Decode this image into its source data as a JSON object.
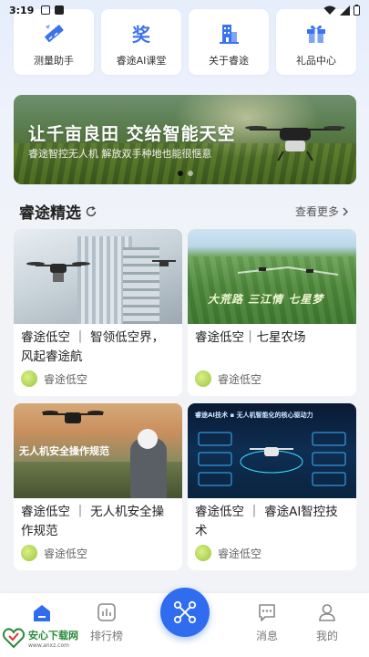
{
  "status_bar": {
    "time": "3:19"
  },
  "quick_menu": [
    {
      "label": "测量助手",
      "icon": "ruler-icon"
    },
    {
      "label": "睿途AI课堂",
      "icon": "award-icon"
    },
    {
      "label": "关于睿途",
      "icon": "building-icon"
    },
    {
      "label": "礼品中心",
      "icon": "gift-icon"
    }
  ],
  "banner": {
    "title": "让千亩良田 交给智能天空",
    "subtitle": "睿途智控无人机 解放双手种地也能很惬意"
  },
  "section": {
    "title": "睿途精选",
    "more_label": "查看更多"
  },
  "cards": [
    {
      "title": "睿途低空 ｜ 智领低空界，风起睿途航",
      "author": "睿途低空",
      "img_text": ""
    },
    {
      "title": "睿途低空｜七星农场",
      "author": "睿途低空",
      "img_text": "大荒路 三江情 七星梦"
    },
    {
      "title": "睿途低空 ｜ 无人机安全操作规范",
      "author": "睿途低空",
      "img_text": "无人机安全操作规范"
    },
    {
      "title": "睿途低空 ｜ 睿途AI智控技术",
      "author": "睿途低空",
      "img_text": "睿途AI技术 ▪ 无人机智能化的核心驱动力"
    }
  ],
  "nav": [
    {
      "label": "",
      "icon": "home-icon"
    },
    {
      "label": "排行榜",
      "icon": "chart-icon"
    },
    {
      "label": "消息",
      "icon": "message-icon"
    },
    {
      "label": "我的",
      "icon": "user-icon"
    }
  ],
  "watermark": {
    "text": "安心下载网",
    "url": "www.anxz.com"
  },
  "colors": {
    "accent": "#2f6cf0",
    "background": "#f1f3f7"
  }
}
